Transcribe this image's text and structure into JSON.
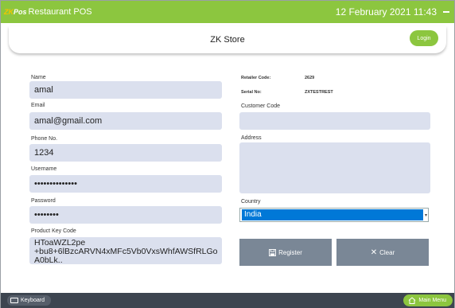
{
  "titlebar": {
    "logo_zk": "ZK",
    "logo_pos": "Pos",
    "app_title": "Restaurant POS",
    "datetime": "12 February 2021 11:43"
  },
  "header": {
    "store_name": "ZK Store",
    "login_label": "Login"
  },
  "form": {
    "name_label": "Name",
    "name_value": "amal",
    "email_label": "Email",
    "email_value": "amal@gmail.com",
    "phone_label": "Phone No.",
    "phone_value": "1234",
    "username_label": "Username",
    "username_value": "••••••••••••••",
    "password_label": "Password",
    "password_value": "••••••••",
    "product_key_label": "Product Key Code",
    "product_key_value": "HToaWZL2pe +bu8+6lBzcARVN4xMFc5Vb0VxsWhfAWSfRLGo A0bLk..",
    "retailer_code_label": "Retailer Code:",
    "retailer_code_value": "2629",
    "serial_no_label": "Serial No:",
    "serial_no_value": "ZXTESTREST",
    "customer_code_label": "Customer Code",
    "customer_code_value": "",
    "address_label": "Address",
    "address_value": "",
    "country_label": "Country",
    "country_value": "India"
  },
  "buttons": {
    "register_label": "Register",
    "clear_label": "Clear"
  },
  "footer": {
    "keyboard_label": "Keyboard",
    "main_menu_label": "Main Menu"
  },
  "colors": {
    "accent": "#8cc63f",
    "field_bg": "#dbe0ee",
    "button_bg": "#7a8796",
    "footer_bg": "#3d4550",
    "selection": "#0078d7"
  }
}
